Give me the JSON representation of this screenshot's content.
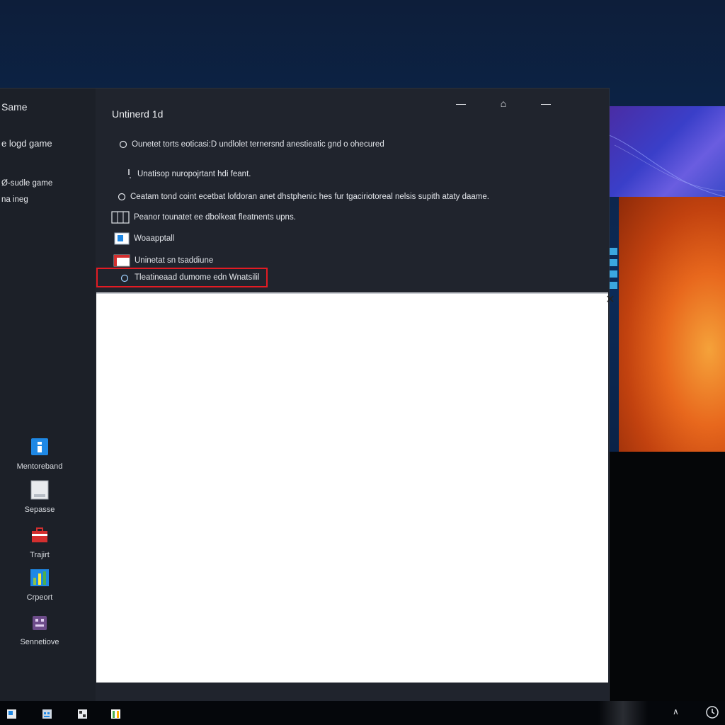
{
  "window": {
    "title": "Untinerd 1d",
    "controls": {
      "minimize": "—",
      "restore": "⌂",
      "close": "—"
    }
  },
  "sidebar": {
    "top_items": [
      {
        "label": "Same"
      },
      {
        "label": "e logd game"
      },
      {
        "label": "Ø-sudle game"
      },
      {
        "label": "na ineg"
      }
    ],
    "apps": [
      {
        "label": "Mentoreband",
        "icon": "blue-app-icon"
      },
      {
        "label": "Sepasse",
        "icon": "document-icon"
      },
      {
        "label": "Trajirt",
        "icon": "toolbox-icon"
      },
      {
        "label": "Crpeort",
        "icon": "chart-icon"
      },
      {
        "label": "Sennetiove",
        "icon": "device-icon"
      }
    ]
  },
  "content": {
    "lines": [
      {
        "text": "Ounetet torts eoticasi:D undlolet ternersnd anestieatic gnd o ohecured",
        "icon": "circle-icon"
      },
      {
        "text": "Unatisop nuropojrtant hdi feant.",
        "icon": "cursor-icon"
      },
      {
        "text": "Ceatam tond coint ecetbat lofdoran anet dhstphenic hes fur tgaciriotoreal nelsis supith ataty daame.",
        "icon": "circle-icon"
      },
      {
        "text": "Peanor tounatet ee dbolkeat fleatnents upns.",
        "icon": "grid-icon"
      },
      {
        "text": "Woaapptall",
        "icon": "app-window-icon"
      },
      {
        "text": "Uninetat sn tsaddiune",
        "icon": "red-window-icon"
      }
    ],
    "highlighted": {
      "text": "Tleatineaad dumome edn Wnatsilil",
      "icon": "circle-icon"
    }
  },
  "dialog": {
    "close": "✕"
  },
  "taskbar": {
    "icons": [
      "start-icon",
      "calendar-icon",
      "grid-app-icon",
      "chart-app-icon"
    ],
    "chevron": "∧"
  },
  "colors": {
    "window_bg": "#20242d",
    "sidebar_bg": "#1c2028",
    "highlight_border": "#e31b23",
    "accent_blue": "#1e88e5"
  }
}
